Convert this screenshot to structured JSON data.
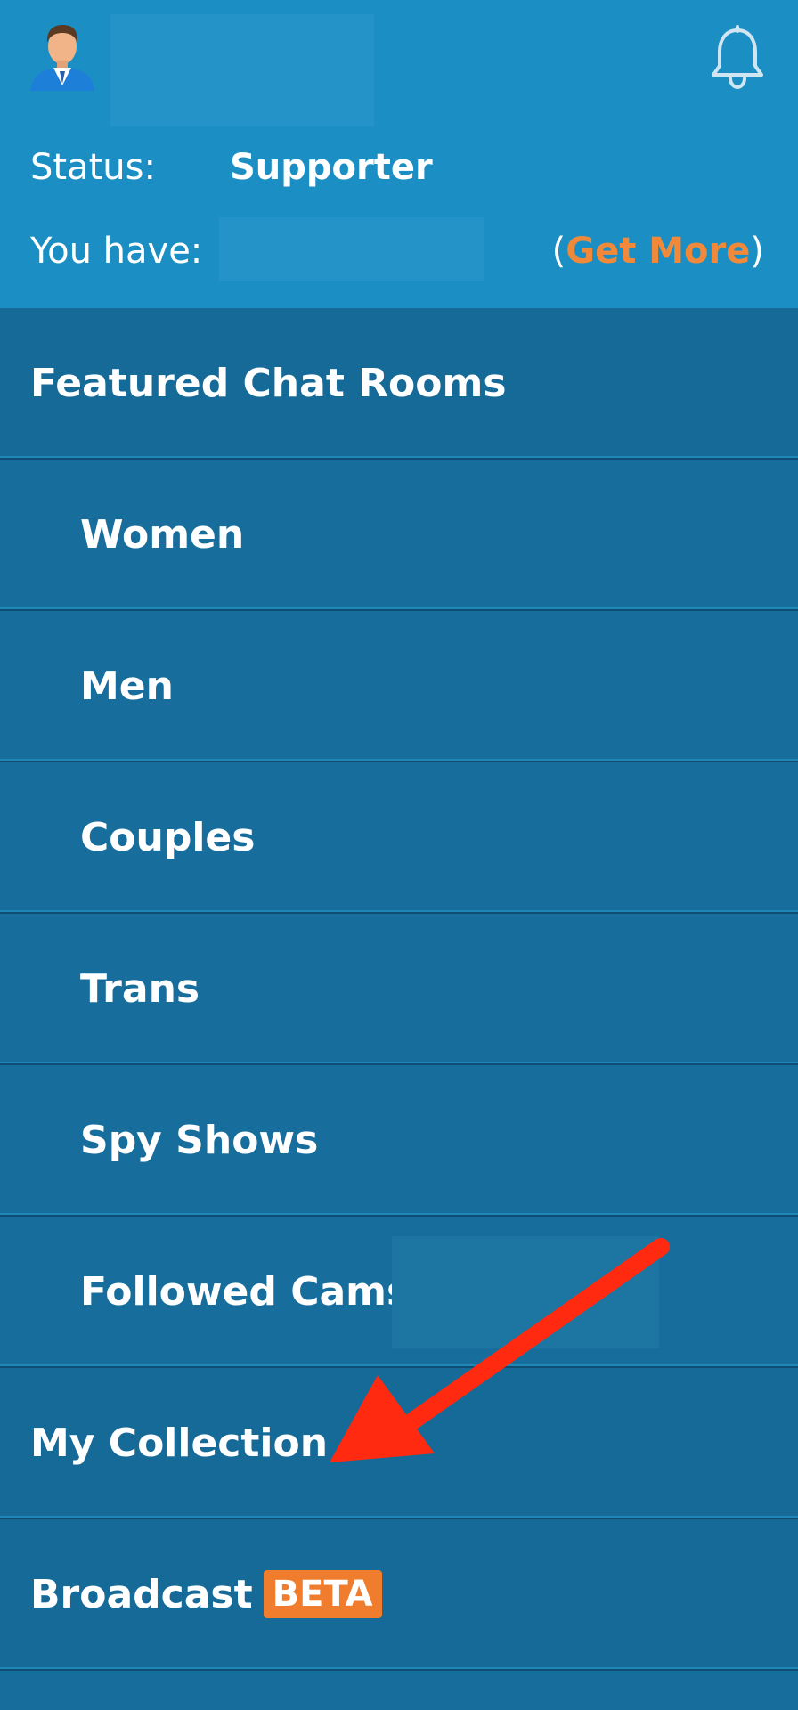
{
  "header": {
    "status_label": "Status:",
    "status_value": "Supporter",
    "have_label": "You have:",
    "get_more_open": "(",
    "get_more_link": "Get More",
    "get_more_close": ")",
    "avatar_icon": "user-avatar-icon",
    "bell_icon": "bell-icon"
  },
  "menu": {
    "items": [
      {
        "label": "Featured Chat Rooms"
      },
      {
        "label": "Women"
      },
      {
        "label": "Men"
      },
      {
        "label": "Couples"
      },
      {
        "label": "Trans"
      },
      {
        "label": "Spy Shows"
      },
      {
        "label": "Followed Cams"
      },
      {
        "label": "My Collection"
      },
      {
        "label": "Broadcast",
        "badge": "BETA"
      }
    ]
  },
  "colors": {
    "header_bg": "#1b8fc4",
    "menu_bg": "#176e9d",
    "accent_orange": "#f07d2e",
    "annotation_arrow": "#ff2a10"
  }
}
